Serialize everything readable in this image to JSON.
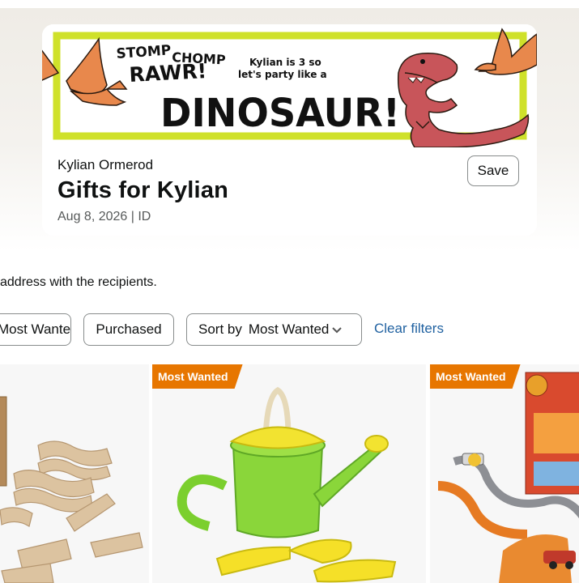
{
  "banner": {
    "stomp_text": "STOMP",
    "chomp_text": "CHOMP",
    "rawr_text": "RAWR!",
    "party_line1": "Kylian is 3 so",
    "party_line2": "let's party like a",
    "headline": "DINOSAUR!",
    "colors": {
      "frame": "#cfe12a",
      "ink": "#111111",
      "dino": "#c8555a",
      "pterodactyl": "#e8884c"
    }
  },
  "list": {
    "owner": "Kylian Ormerod",
    "title": "Gifts for Kylian",
    "meta": "Aug 8, 2026 | ID",
    "save_label": "Save"
  },
  "notice": "address with the recipients.",
  "filters": {
    "most_wanted": "Most Wanted",
    "purchased": "Purchased",
    "sort_label": "Sort by",
    "sort_value": "Most Wanted",
    "clear": "Clear filters"
  },
  "products": [
    {
      "badge": "",
      "image": "wooden-train-track-pieces"
    },
    {
      "badge": "Most Wanted",
      "image": "green-watering-can-and-yellow-shovels"
    },
    {
      "badge": "Most Wanted",
      "image": "race-car-track-playset"
    }
  ],
  "colors": {
    "badge": "#e77600",
    "link": "#2162a1",
    "text": "#0f1111",
    "muted": "#565959"
  }
}
